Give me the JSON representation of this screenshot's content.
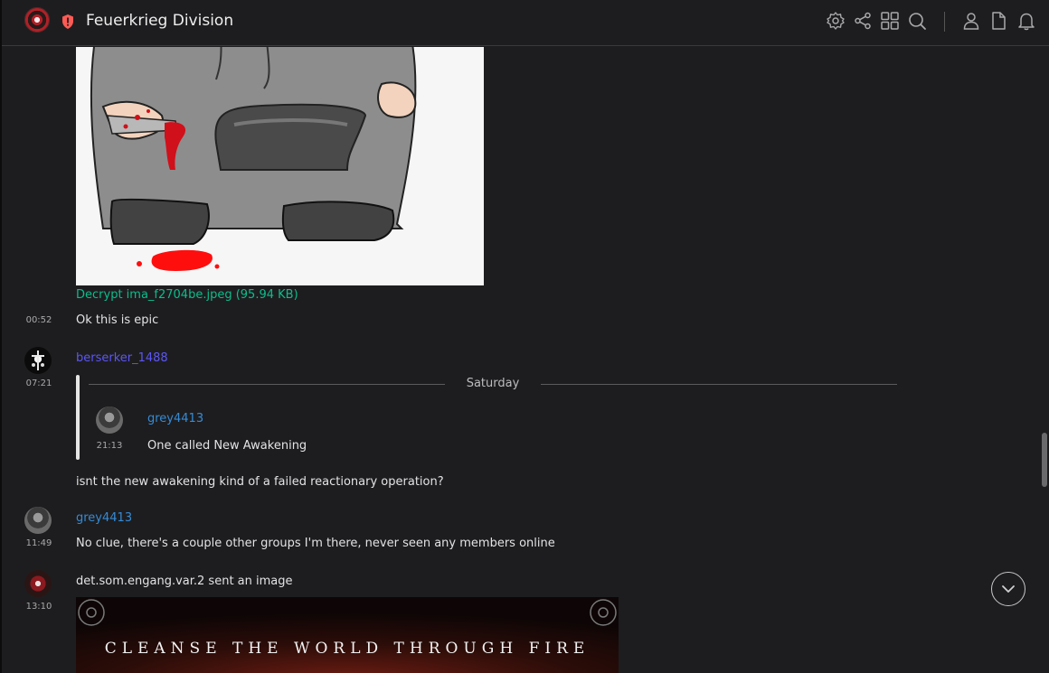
{
  "room": {
    "title": "Feuerkrieg Division"
  },
  "header": {
    "icons": [
      "settings-icon",
      "share-icon",
      "apps-grid-icon",
      "search-icon",
      "people-icon",
      "files-icon",
      "notifications-icon"
    ]
  },
  "timeline": {
    "first_image_caption": "Decrypt ima_f2704be.jpeg (95.94 KB)",
    "messages": [
      {
        "time": "00:52",
        "text": "Ok this is epic"
      },
      {
        "time": "07:21",
        "sender": "berserker_1488",
        "text": "isnt the new awakening kind of a failed reactionary operation?"
      },
      {
        "time": "11:49",
        "sender": "grey4413",
        "text": "No clue, there's a couple other groups I'm there, never seen any members online"
      },
      {
        "time": "13:10",
        "text": "det.som.engang.var.2 sent an image"
      }
    ],
    "day_separator": "Saturday",
    "quote": {
      "time": "21:13",
      "sender": "grey4413",
      "text": "One called New Awakening"
    },
    "second_image_text": "CLEANSE THE WORLD THROUGH FIRE"
  },
  "colors": {
    "background": "#1d1d1f",
    "link_green": "#0dbd8b",
    "sender_berserker": "#5c56f5",
    "sender_grey": "#368bd6"
  }
}
